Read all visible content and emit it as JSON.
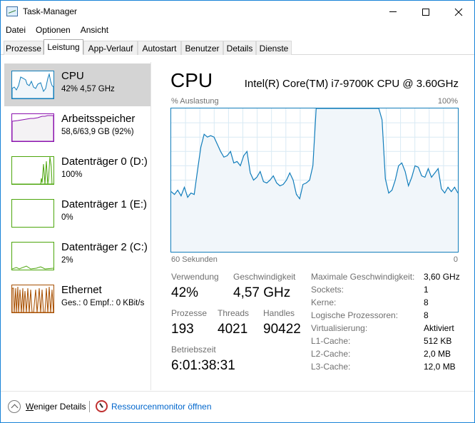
{
  "window": {
    "title": "Task-Manager",
    "accent_color": "#1883d7"
  },
  "menu": [
    "Datei",
    "Optionen",
    "Ansicht"
  ],
  "tabs": [
    "Prozesse",
    "Leistung",
    "App-Verlauf",
    "Autostart",
    "Benutzer",
    "Details",
    "Dienste"
  ],
  "active_tab": "Leistung",
  "sidebar": [
    {
      "name": "CPU",
      "sub": "42% 4,57 GHz",
      "color": "#117dbb",
      "fill": "#f1f6fa"
    },
    {
      "name": "Arbeitsspeicher",
      "sub": "58,6/63,9 GB (92%)",
      "color": "#8b12ae",
      "fill": "#f4f2f4"
    },
    {
      "name": "Datenträger 0 (D:)",
      "sub": "100%",
      "color": "#4da60c",
      "fill": "#eff7ea"
    },
    {
      "name": "Datenträger 1 (E:)",
      "sub": "0%",
      "color": "#4da60c",
      "fill": "#eff7ea"
    },
    {
      "name": "Datenträger 2 (C:)",
      "sub": "2%",
      "color": "#4da60c",
      "fill": "#eff7ea"
    },
    {
      "name": "Ethernet",
      "sub": "Ges.: 0 Empf.: 0 KBit/s",
      "color": "#a74f01",
      "fill": "#fcf3eb"
    }
  ],
  "main": {
    "title": "CPU",
    "model": "Intel(R) Core(TM) i7-9700K CPU @ 3.60GHz",
    "graph_label_left": "% Auslastung",
    "graph_label_right": "100%",
    "graph_time_left": "60 Sekunden",
    "graph_time_right": "0",
    "graph_color": "#117dbb",
    "graph_fill": "#f1f6fa",
    "grid_color": "#d9eaf4",
    "cpu_history_percent": [
      42,
      40,
      43,
      39,
      45,
      38,
      41,
      40,
      57,
      73,
      82,
      80,
      81,
      80,
      75,
      70,
      66,
      67,
      70,
      62,
      63,
      60,
      67,
      70,
      55,
      50,
      52,
      56,
      49,
      48,
      50,
      53,
      48,
      46,
      47,
      50,
      55,
      50,
      40,
      37,
      47,
      48,
      50,
      60,
      100,
      100,
      100,
      100,
      100,
      100,
      100,
      100,
      100,
      100,
      100,
      100,
      100,
      100,
      100,
      100,
      100,
      100,
      100,
      100,
      92,
      51,
      41,
      43,
      50,
      60,
      62,
      56,
      46,
      52,
      60,
      59,
      53,
      52,
      58,
      52,
      55,
      58,
      44,
      41,
      45,
      42,
      45,
      41
    ]
  },
  "stats": {
    "usage_label": "Verwendung",
    "usage_value": "42%",
    "speed_label": "Geschwindigkeit",
    "speed_value": "4,57 GHz",
    "proc_label": "Prozesse",
    "proc_value": "193",
    "threads_label": "Threads",
    "threads_value": "4021",
    "handles_label": "Handles",
    "handles_value": "90422",
    "uptime_label": "Betriebszeit",
    "uptime_value": "6:01:38:31"
  },
  "specs": [
    {
      "label": "Maximale Geschwindigkeit:",
      "value": "3,60 GHz"
    },
    {
      "label": "Sockets:",
      "value": "1"
    },
    {
      "label": "Kerne:",
      "value": "8"
    },
    {
      "label": "Logische Prozessoren:",
      "value": "8"
    },
    {
      "label": "Virtualisierung:",
      "value": "Aktiviert"
    },
    {
      "label": "L1-Cache:",
      "value": "512 KB"
    },
    {
      "label": "L2-Cache:",
      "value": "2,0 MB"
    },
    {
      "label": "L3-Cache:",
      "value": "12,0 MB"
    }
  ],
  "footer": {
    "fewer": "Weniger Details",
    "fewer_underline": "W",
    "resmon": "Ressourcenmonitor öffnen"
  }
}
